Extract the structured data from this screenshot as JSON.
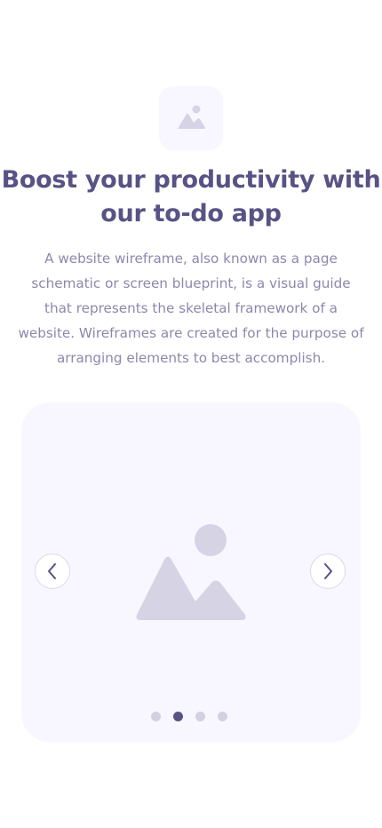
{
  "header": {
    "logo_icon": "image-placeholder-icon",
    "title": "Boost your productivity with our to-do app",
    "description": "A website wireframe, also known as a page schematic or screen blueprint, is a visual guide that represents the skeletal framework of a website. Wireframes are created for the purpose of arranging elements to best accomplish."
  },
  "carousel": {
    "slide_icon": "image-placeholder-icon",
    "prev_icon": "chevron-left-icon",
    "next_icon": "chevron-right-icon",
    "active_index": 1,
    "total": 4
  },
  "colors": {
    "primary": "#575385",
    "text_muted": "#8C88AC",
    "surface": "#F8F7FF",
    "placeholder": "#D6D3E5",
    "dot_inactive": "#D3D0E2"
  }
}
